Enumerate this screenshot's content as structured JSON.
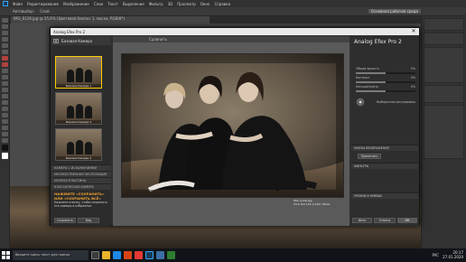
{
  "ps": {
    "menu": [
      "Файл",
      "Редактирование",
      "Изображение",
      "Слои",
      "Текст",
      "Выделение",
      "Фильтр",
      "3D",
      "Просмотр",
      "Окно",
      "Справка"
    ],
    "options_text": "Автовыбор:",
    "options_value": "Слой",
    "doc_tab": "IMG_0126.jpg @ 25,6% (Цветовой баланс 1, маска, RGB/8*)",
    "right_tab": "Основная рабочая среда",
    "tools_count": 24
  },
  "plugin": {
    "title": "Analog Efex Pro 2",
    "brand": "Analog Efex Pro 2",
    "left_header": "Базовая Камера",
    "thumbs": [
      {
        "label": "Базовая Камера 1",
        "selected": true
      },
      {
        "label": "Базовая Камера 2",
        "selected": false
      },
      {
        "label": "Базовая Камера 3",
        "selected": false
      }
    ],
    "accordions": [
      "КАМЕРА С ИСКАЖЕНИЯМИ",
      "МНОЖЕСТВЕННАЯ ЭКСПОЗИЦИЯ",
      "МОКРАЯ ПЛАСТИНА",
      "КЛАССИЧЕСКАЯ КАМЕРА"
    ],
    "promo_title": "НАЖМИТЕ «СОХРАНИТЬ» ИЛИ «СОХРАНИТЬ ВСЁ»",
    "promo_body": "Нажмите кнопку, чтобы сохранить эти камеры в избранное.",
    "center_bar_label": "Сравнить",
    "caption_line1": "IMG_0126.jpg",
    "caption_line2": "f/5.6 ISO 100 1/125с 85мм",
    "right": {
      "rows": [
        {
          "label": "Общая яркость",
          "value": "0%"
        },
        {
          "label": "Контраст",
          "value": "0%"
        },
        {
          "label": "Насыщенность",
          "value": "0%"
        }
      ],
      "sections": [
        "ЛИНЗЫ ИЗОБРАЖЕНИЯ",
        "ФИЛЬТРЫ",
        "УРОВНИ И КРИВЫЕ"
      ],
      "adjust_label": "Выборочная регулировка",
      "apply_label": "Применить"
    },
    "bottom_left_buttons": [
      "Сохранить",
      "Вид"
    ],
    "bottom_right_buttons": [
      "Фото",
      "Отмена",
      "ОК"
    ]
  },
  "taskbar": {
    "search_placeholder": "Введите здесь текст для поиска",
    "time": "20:17",
    "date": "27.01.2020",
    "lang": "РУС"
  }
}
